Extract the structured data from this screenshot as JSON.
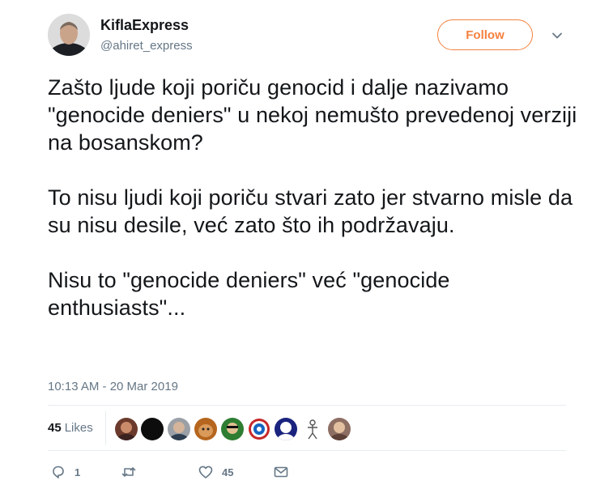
{
  "user": {
    "name": "KiflaExpress",
    "handle": "@ahiret_express"
  },
  "follow_label": "Follow",
  "tweet": {
    "paragraphs": [
      "Zašto ljude koji poriču genocid i dalje nazivamo \"genocide deniers\" u nekoj nemušto prevedenoj verziji na bosanskom?",
      "To nisu ljudi koji poriču stvari zato jer stvarno misle da su nisu desile, već zato što ih podržavaju.",
      "Nisu to \"genocide deniers\" već \"genocide enthusiasts\"..."
    ],
    "timestamp": "10:13 AM - 20 Mar 2019"
  },
  "likes": {
    "count": "45",
    "label": "Likes"
  },
  "actions": {
    "reply_count": "1",
    "like_count": "45"
  },
  "colors": {
    "accent": "#f5813f",
    "secondary_text": "#657786",
    "divider": "#e6ecf0"
  },
  "icons": [
    "chevron-down-icon",
    "reply-icon",
    "retweet-icon",
    "heart-icon",
    "envelope-icon"
  ]
}
